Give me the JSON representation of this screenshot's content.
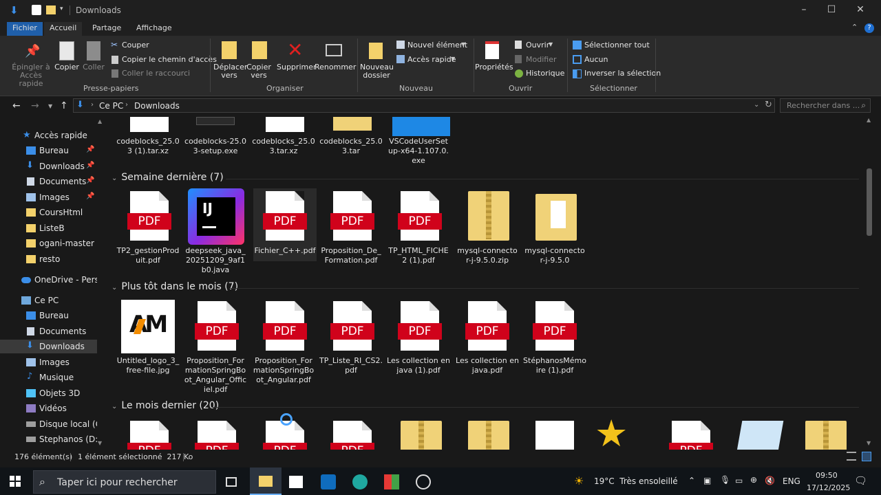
{
  "window": {
    "title": "Downloads"
  },
  "tabs": [
    "Fichier",
    "Accueil",
    "Partage",
    "Affichage"
  ],
  "ribbon": {
    "pin": "Épingler à\nAccès rapide",
    "copy": "Copier",
    "paste": "Coller",
    "cut": "Couper",
    "copy_path": "Copier le chemin d'accès",
    "paste_shortcut": "Coller le raccourci",
    "move_to": "Déplacer vers",
    "copy_to": "Copier vers",
    "delete": "Supprimer",
    "rename": "Renommer",
    "new_folder": "Nouveau dossier",
    "new_item": "Nouvel élément",
    "easy_access": "Accès rapide",
    "properties": "Propriétés",
    "open": "Ouvrir",
    "edit": "Modifier",
    "history": "Historique",
    "select_all": "Sélectionner tout",
    "select_none": "Aucun",
    "invert": "Inverser la sélection",
    "groups": {
      "clipboard": "Presse-papiers",
      "organize": "Organiser",
      "new": "Nouveau",
      "open": "Ouvrir",
      "select": "Sélectionner"
    }
  },
  "address": {
    "crumb1": "Ce PC",
    "crumb2": "Downloads",
    "search_placeholder": "Rechercher dans ..."
  },
  "nav": {
    "quick": "Accès rapide",
    "items": [
      "Bureau",
      "Downloads",
      "Documents",
      "Images",
      "CoursHtml",
      "ListeB",
      "ogani-master",
      "resto"
    ],
    "onedrive": "OneDrive - Personal",
    "pc": "Ce PC",
    "pc_items": [
      "Bureau",
      "Documents",
      "Downloads",
      "Images",
      "Musique",
      "Objets 3D",
      "Vidéos",
      "Disque local (C:)",
      "Stephanos (D:)"
    ]
  },
  "groups": {
    "top_files": [
      "codeblocks_25.03 (1).tar.xz",
      "codeblocks-25.03-setup.exe",
      "codeblocks_25.03.tar.xz",
      "codeblocks_25.03.tar",
      "VSCodeUserSetup-x64-1.107.0.exe"
    ],
    "last_week": {
      "header": "Semaine dernière (7)",
      "files": [
        "TP2_gestionProduit.pdf",
        "deepseek_java_20251209_9af1b0.java",
        "Fichier_C++.pdf",
        "Proposition_De_Formation.pdf",
        "TP_HTML_FICHE 2 (1).pdf",
        "mysql-connector-j-9.5.0.zip",
        "mysql-connector-j-9.5.0"
      ]
    },
    "earlier_month": {
      "header": "Plus tôt dans le mois (7)",
      "files": [
        "Untitled_logo_3_free-file.jpg",
        "Proposition_FormationSpringBoot_Angular_Officiel.pdf",
        "Proposition_FormationSpringBoot_Angular.pdf",
        "TP_Liste_RI_CS2.pdf",
        "Les collection en java (1).pdf",
        "Les collection en java.pdf",
        "StéphanosMémoire (1).pdf"
      ]
    },
    "last_month": {
      "header": "Le mois dernier (20)"
    }
  },
  "icons": {
    "pdf_label": "PDF",
    "ij_label": "IJ",
    "logo_label": "AM"
  },
  "status": {
    "count": "176 élément(s)",
    "selected": "1 élément sélectionné  217 Ko"
  },
  "taskbar": {
    "search": "Taper ici pour rechercher",
    "weather": "19°C  Très ensoleillé",
    "lang": "ENG",
    "time": "09:50",
    "date": "17/12/2025"
  }
}
